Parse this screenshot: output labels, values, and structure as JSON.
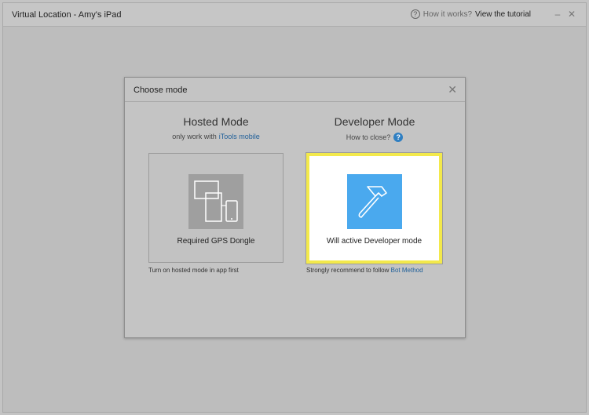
{
  "window": {
    "title": "Virtual Location - Amy's iPad",
    "help_text": "How it works?",
    "tutorial_link": "View the tutorial",
    "minimize_glyph": "–",
    "close_glyph": "✕"
  },
  "dialog": {
    "title": "Choose mode",
    "close_glyph": "✕",
    "hosted": {
      "title": "Hosted Mode",
      "subtitle_prefix": "only work with",
      "subtitle_link": "iTools mobile",
      "card_label": "Required GPS Dongle",
      "note": "Turn on hosted mode in app first",
      "icon": "devices-icon"
    },
    "developer": {
      "title": "Developer Mode",
      "subtitle": "How to close?",
      "info_glyph": "?",
      "card_label": "Will active Developer mode",
      "note_prefix": "Strongly recommend to follow",
      "note_link": "Bot Method",
      "icon": "hammer-icon",
      "selected": true
    }
  },
  "colors": {
    "accent_blue": "#4aa9ee",
    "highlight_yellow": "#f3e94b",
    "link_blue": "#1f5f99"
  }
}
